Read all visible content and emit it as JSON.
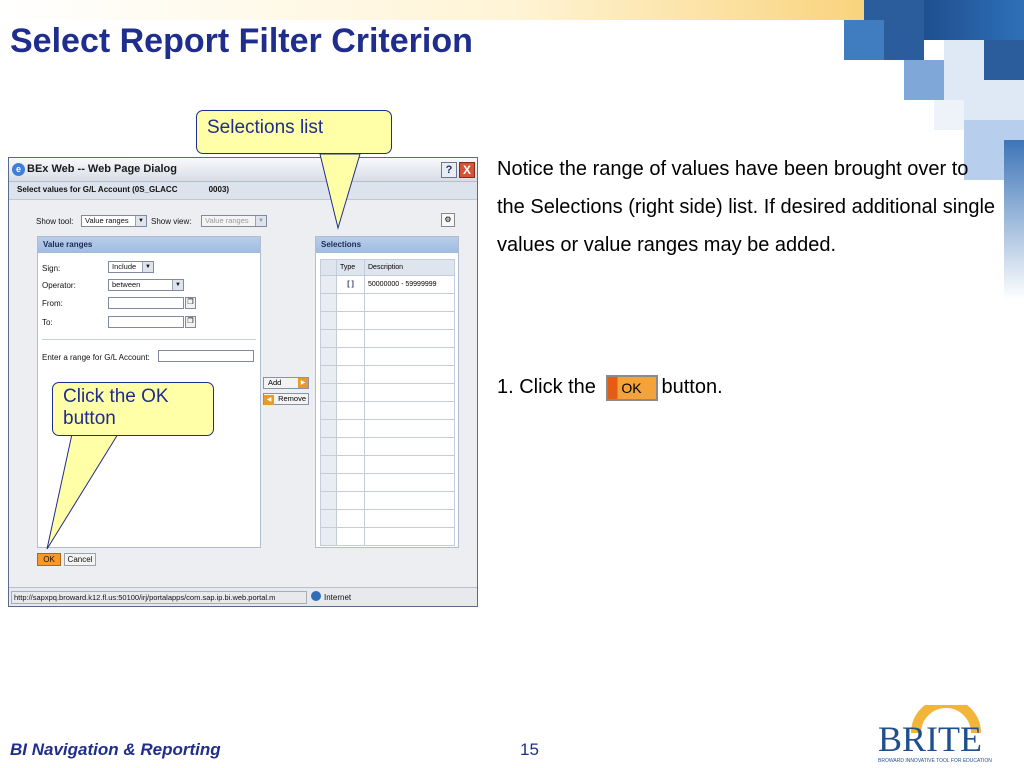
{
  "slide": {
    "title": "Select Report Filter Criterion",
    "notice": "Notice the range of values have been brought over to the Selections (right side) list.  If desired additional single values or value ranges may be added.",
    "step_prefix": "1.  Click the",
    "step_ok": "OK",
    "step_suffix": "button.",
    "footer_left": "BI Navigation & Reporting",
    "page_number": "15",
    "logo_text": "BRITE",
    "logo_tagline": "BROWARD INNOVATIVE TOOL FOR EDUCATION"
  },
  "callouts": {
    "selections": "Selections list",
    "ok": "Click the OK button"
  },
  "dialog": {
    "title": "BEx Web -- Web Page Dialog",
    "help": "?",
    "close": "X",
    "subheader": "Select values for G/L Account (0S_GLACC              0003)",
    "show_tool_label": "Show tool:",
    "show_tool_value": "Value ranges",
    "show_view_label": "Show view:",
    "show_view_value": "Value ranges",
    "value_ranges": {
      "header": "Value ranges",
      "sign_label": "Sign:",
      "sign_value": "Include",
      "operator_label": "Operator:",
      "operator_value": "between",
      "from_label": "From:",
      "to_label": "To:",
      "enter_range_label": "Enter a range for G/L Account:"
    },
    "add_label": "Add",
    "remove_label": "Remove",
    "selections": {
      "header": "Selections",
      "columns": [
        "Type",
        "Description"
      ],
      "rows": [
        {
          "type": "[ ]",
          "description": "50000000 - 59999999"
        }
      ]
    },
    "ok_label": "OK",
    "cancel_label": "Cancel",
    "status_url": "http://sapxpq.broward.k12.fl.us:50100/irj/portalapps/com.sap.ip.bi.web.portal.m",
    "status_zone": "Internet"
  }
}
